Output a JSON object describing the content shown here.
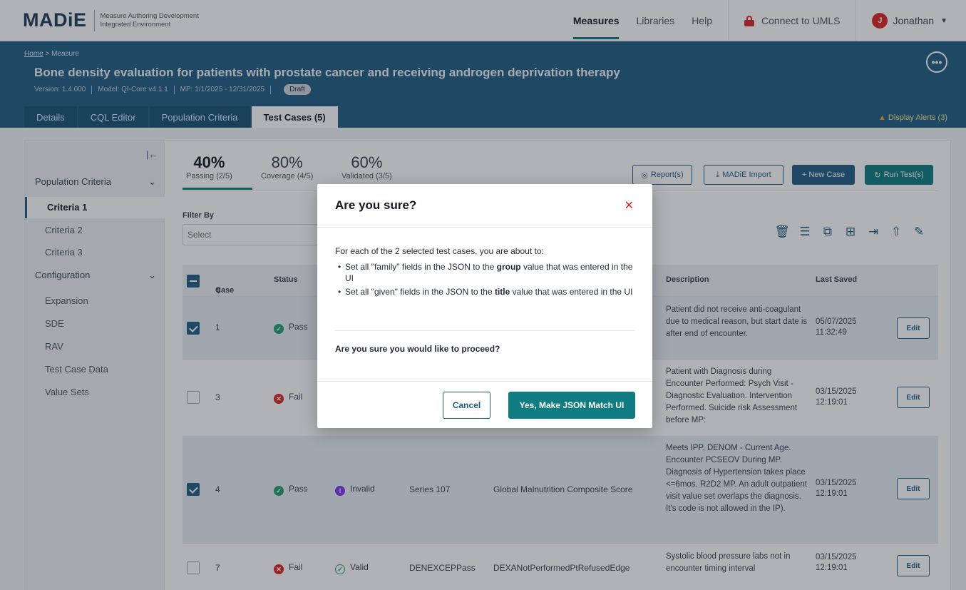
{
  "app": {
    "logo": "MADiE",
    "subtitle_line1": "Measure Authoring Development",
    "subtitle_line2": "Integrated Environment"
  },
  "nav": {
    "measures": "Measures",
    "libraries": "Libraries",
    "help": "Help",
    "umls": "Connect to UMLS",
    "user_initial": "J",
    "user_name": "Jonathan"
  },
  "header": {
    "breadcrumb_home": "Home",
    "breadcrumb_rest": " > Measure",
    "title": "Bone density evaluation for patients with prostate cancer and receiving androgen deprivation therapy",
    "version": "Version: 1.4.000",
    "model": "Model: QI-Core v4.1.1",
    "mp": "MP: 1/1/2025 - 12/31/2025",
    "status": "Draft",
    "tabs": [
      "Details",
      "CQL Editor",
      "Population Criteria",
      "Test Cases (5)"
    ],
    "alerts": "Display Alerts (3)"
  },
  "sidebar": {
    "population_criteria": "Population Criteria",
    "criteria": [
      "Criteria 1",
      "Criteria 2",
      "Criteria 3"
    ],
    "configuration": "Configuration",
    "config_items": [
      "Expansion",
      "SDE",
      "RAV",
      "Test Case Data",
      "Value Sets"
    ]
  },
  "stats": {
    "passing_pct": "40%",
    "passing_lbl": "Passing (2/5)",
    "coverage_pct": "80%",
    "coverage_lbl": "Coverage (4/5)",
    "validated_pct": "60%",
    "validated_lbl": "Validated (3/5)"
  },
  "actions": {
    "reports": "Report(s)",
    "import": "MADiE Import",
    "new_case": "+ New Case",
    "run": "Run Test(s)"
  },
  "filter": {
    "label": "Filter By",
    "placeholder": "Select"
  },
  "table": {
    "headers": {
      "case": "Case #",
      "status": "Status",
      "description": "Description",
      "last_saved": "Last Saved"
    },
    "rows": [
      {
        "case": "1",
        "status": "Pass",
        "validation": "",
        "group": "",
        "title": "",
        "description": "Patient did not receive anti-coagulant due to medical reason, but start date is after end of encounter.",
        "saved_date": "05/07/2025",
        "saved_time": "11:32:49",
        "edit": "Edit",
        "selected": true
      },
      {
        "case": "3",
        "status": "Fail",
        "validation": "",
        "group": "",
        "title": "",
        "description": "Patient with Diagnosis during Encounter Performed: Psych Visit - Diagnostic Evaluation. Intervention Performed. Suicide risk Assessment before MP:",
        "saved_date": "03/15/2025",
        "saved_time": "12:19:01",
        "edit": "Edit",
        "selected": false
      },
      {
        "case": "4",
        "status": "Pass",
        "validation": "Invalid",
        "group": "Series 107",
        "title": "Global Malnutrition Composite Score",
        "description": "Meets IPP, DENOM - Current Age. Encounter PCSEOV During MP. Diagnosis of Hypertension takes place <=6mos. R2D2 MP. An adult outpatient visit value set overlaps the diagnosis. It's code is not allowed in the IP).",
        "saved_date": "03/15/2025",
        "saved_time": "12:19:01",
        "edit": "Edit",
        "selected": true
      },
      {
        "case": "7",
        "status": "Fail",
        "validation": "Valid",
        "group": "DENEXCEPPass",
        "title": "DEXANotPerformedPtRefusedEdge",
        "description": "Systolic blood pressure labs not in encounter timing interval",
        "saved_date": "03/15/2025",
        "saved_time": "12:19:01",
        "edit": "Edit",
        "selected": false
      }
    ]
  },
  "modal": {
    "title": "Are you sure?",
    "intro": "For each of the 2 selected test cases, you are about to:",
    "b1_pre": "Set all \"family\" fields in the JSON to the ",
    "b1_bold": "group",
    "b1_post": " value that was entered in the UI",
    "b2_pre": "Set all \"given\" fields in the JSON to the ",
    "b2_bold": "title",
    "b2_post": " value that was entered in the UI",
    "question": "Are you sure you would like to proceed?",
    "cancel": "Cancel",
    "confirm": "Yes, Make JSON Match UI"
  },
  "icons": {
    "toolbar": [
      "trash-icon",
      "columns-icon",
      "copy-icon",
      "export-icon",
      "upload-icon",
      "edit-tag-icon"
    ]
  }
}
